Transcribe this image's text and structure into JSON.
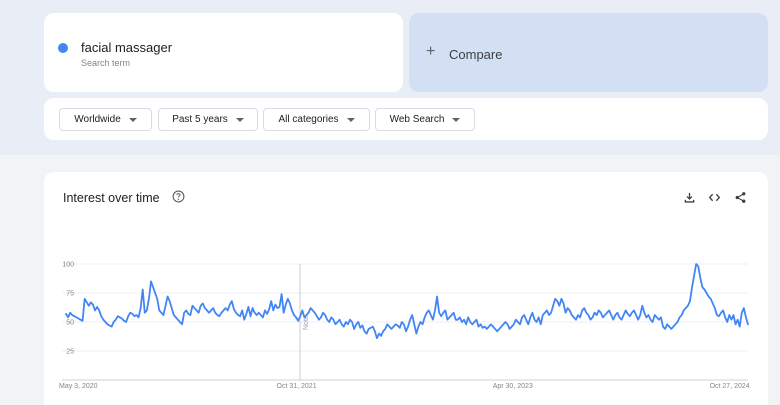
{
  "search_term": {
    "name": "facial massager",
    "subtitle": "Search term",
    "color": "#4285f4"
  },
  "compare": {
    "label": "Compare",
    "icon": "plus-icon"
  },
  "filters": [
    {
      "label": "Worldwide",
      "icon": "caret-down-icon"
    },
    {
      "label": "Past 5 years",
      "icon": "caret-down-icon"
    },
    {
      "label": "All categories",
      "icon": "caret-down-icon"
    },
    {
      "label": "Web Search",
      "icon": "caret-down-icon"
    }
  ],
  "panel": {
    "title": "Interest over time",
    "help_icon": "help-circle-icon",
    "tools": [
      "download-icon",
      "embed-code-icon",
      "share-icon"
    ],
    "note_label": "Note"
  },
  "chart_data": {
    "type": "line",
    "title": "",
    "xlabel": "",
    "ylabel": "",
    "ylim": [
      0,
      100
    ],
    "yticks": [
      25,
      50,
      75,
      100
    ],
    "xticks": [
      "May 3, 2020",
      "Oct 31, 2021",
      "Apr 30, 2023",
      "Oct 27, 2024"
    ],
    "grid": true,
    "line_color": "#4285f4",
    "series": [
      {
        "name": "facial massager",
        "values": [
          57,
          54,
          58,
          56,
          55,
          54,
          53,
          52,
          51,
          70,
          67,
          64,
          67,
          65,
          60,
          63,
          60,
          55,
          52,
          50,
          48,
          47,
          46,
          50,
          52,
          55,
          54,
          53,
          51,
          50,
          55,
          58,
          57,
          55,
          56,
          54,
          62,
          78,
          58,
          60,
          70,
          85,
          80,
          75,
          70,
          60,
          58,
          56,
          64,
          72,
          68,
          62,
          56,
          54,
          52,
          50,
          48,
          58,
          60,
          57,
          56,
          64,
          62,
          60,
          58,
          64,
          66,
          62,
          60,
          58,
          60,
          62,
          58,
          56,
          55,
          58,
          60,
          62,
          60,
          65,
          68,
          61,
          58,
          56,
          55,
          60,
          52,
          57,
          63,
          55,
          62,
          58,
          56,
          58,
          56,
          54,
          60,
          57,
          61,
          68,
          60,
          65,
          62,
          63,
          74,
          58,
          65,
          70,
          66,
          60,
          56,
          54,
          51,
          55,
          60,
          54,
          56,
          58,
          62,
          60,
          58,
          55,
          52,
          54,
          58,
          56,
          52,
          50,
          54,
          52,
          48,
          50,
          52,
          48,
          46,
          50,
          48,
          52,
          50,
          44,
          48,
          50,
          45,
          47,
          42,
          40,
          44,
          45,
          46,
          42,
          36,
          40,
          38,
          42,
          44,
          48,
          46,
          44,
          46,
          48,
          47,
          45,
          50,
          48,
          42,
          46,
          52,
          56,
          48,
          40,
          46,
          50,
          48,
          54,
          58,
          60,
          56,
          52,
          60,
          72,
          58,
          55,
          58,
          60,
          52,
          54,
          56,
          58,
          52,
          52,
          54,
          50,
          52,
          48,
          54,
          50,
          48,
          50,
          52,
          46,
          48,
          45,
          46,
          44,
          46,
          48,
          46,
          44,
          42,
          44,
          46,
          48,
          50,
          48,
          44,
          46,
          48,
          52,
          50,
          48,
          54,
          56,
          52,
          48,
          54,
          58,
          52,
          50,
          54,
          48,
          56,
          58,
          60,
          56,
          58,
          64,
          70,
          68,
          64,
          70,
          66,
          58,
          62,
          60,
          56,
          54,
          52,
          56,
          54,
          60,
          62,
          58,
          56,
          52,
          54,
          58,
          56,
          60,
          58,
          54,
          56,
          58,
          60,
          56,
          52,
          56,
          58,
          54,
          52,
          56,
          60,
          57,
          55,
          58,
          60,
          56,
          52,
          56,
          64,
          58,
          54,
          56,
          52,
          50,
          56,
          54,
          52,
          54,
          46,
          44,
          48,
          46,
          44,
          46,
          48,
          50,
          54,
          56,
          60,
          62,
          64,
          68,
          80,
          90,
          100,
          98,
          88,
          80,
          78,
          75,
          72,
          70,
          66,
          62,
          56,
          55,
          58,
          60,
          54,
          50,
          56,
          52,
          56,
          48,
          52,
          46,
          58,
          62,
          54,
          48
        ]
      }
    ]
  }
}
